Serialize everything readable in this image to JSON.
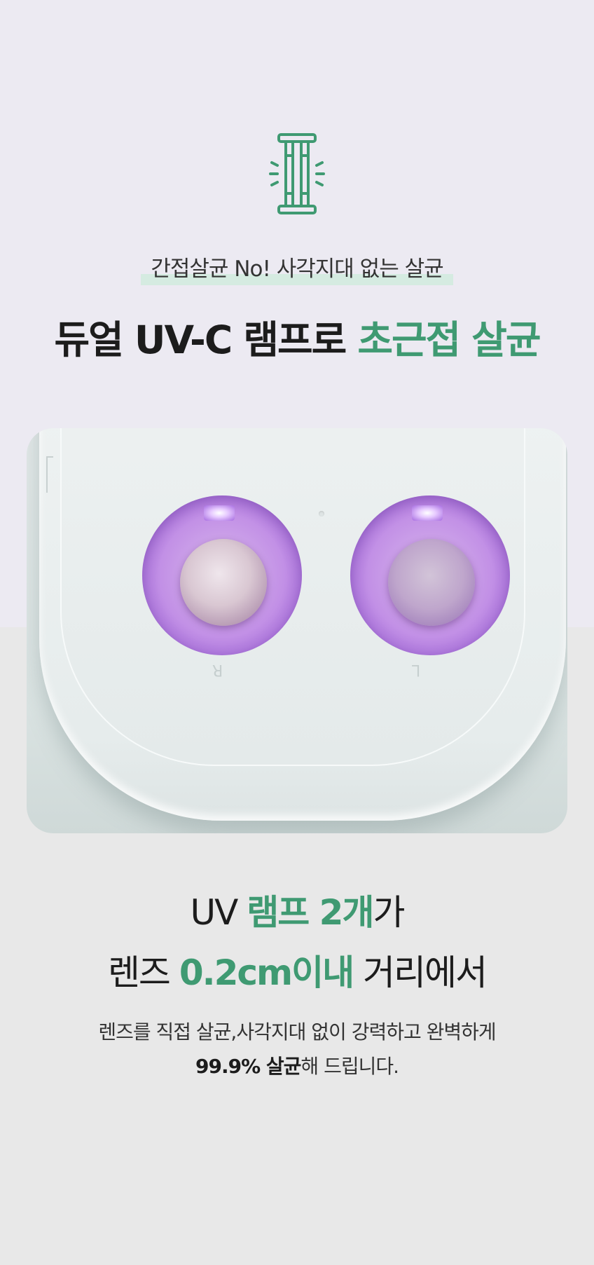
{
  "header": {
    "subtitle": "간접살균 No! 사각지대 없는 살균",
    "headline_main": "듀얼 UV-C 램프로 ",
    "headline_accent": "초근접 살균"
  },
  "feature": {
    "line1_pre": "UV ",
    "line1_accent": "램프 2개",
    "line1_post": "가",
    "line2_pre": "렌즈 ",
    "line2_accent": "0.2cm이내",
    "line2_post": " 거리에서"
  },
  "description": {
    "line1": "렌즈를 직접 살균,사각지대 없이 강력하고 완벽하게",
    "line2_bold": "99.9% 살균",
    "line2_rest": "해 드립니다."
  },
  "photo": {
    "mark_right": "R",
    "mark_left": "L"
  },
  "colors": {
    "accent": "#3f9a72",
    "highlight": "#d5ebe1",
    "top_background": "#eceaf2",
    "bottom_background": "#e8e8e8"
  },
  "icons": {
    "lamp": "uv-lamp-icon"
  }
}
